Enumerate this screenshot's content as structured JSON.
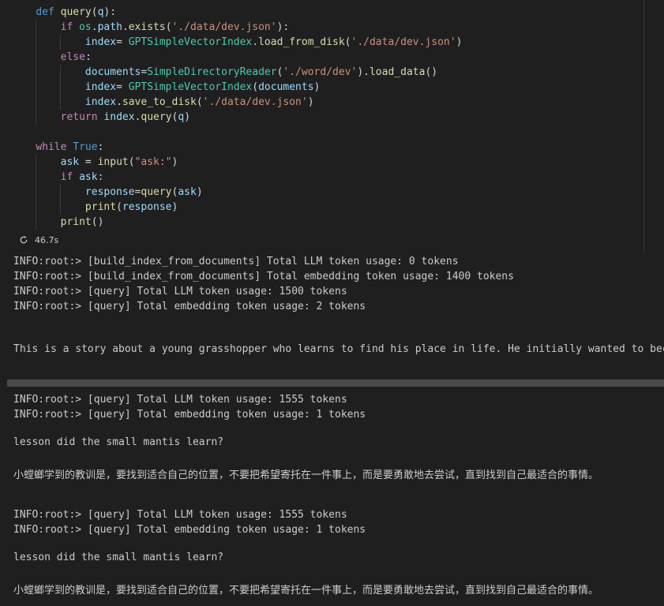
{
  "code": {
    "l1": {
      "kw": "def",
      "fn": "query",
      "open": "(",
      "param": "q",
      "close": "):"
    },
    "l2": {
      "kw": "if",
      "mod": "os",
      "dot1": ".",
      "attr": "path",
      "dot2": ".",
      "fn": "exists",
      "open": "(",
      "str": "'./data/dev.json'",
      "close": "):"
    },
    "l3": {
      "var": "index",
      "eq": "= ",
      "cls": "GPTSimpleVectorIndex",
      "dot": ".",
      "fn": "load_from_disk",
      "open": "(",
      "str": "'./data/dev.json'",
      "close": ")"
    },
    "l4": {
      "kw": "else",
      "colon": ":"
    },
    "l5": {
      "var": "documents",
      "eq": "=",
      "cls": "SimpleDirectoryReader",
      "open": "(",
      "str": "'./word/dev'",
      "close": ").",
      "fn": "load_data",
      "tail": "()"
    },
    "l6": {
      "var": "index",
      "eq": "= ",
      "cls": "GPTSimpleVectorIndex",
      "open": "(",
      "arg": "documents",
      "close": ")"
    },
    "l7": {
      "var": "index",
      "dot": ".",
      "fn": "save_to_disk",
      "open": "(",
      "str": "'./data/dev.json'",
      "close": ")"
    },
    "l8": {
      "kw": "return",
      "var": "index",
      "dot": ".",
      "fn": "query",
      "open": "(",
      "arg": "q",
      "close": ")"
    },
    "l10": {
      "kw": "while",
      "const": "True",
      "colon": ":"
    },
    "l11": {
      "var": "ask",
      "eq": " = ",
      "fn": "input",
      "open": "(",
      "str": "\"ask:\"",
      "close": ")"
    },
    "l12": {
      "kw": "if",
      "var": "ask",
      "colon": ":"
    },
    "l13": {
      "var": "response",
      "eq": "=",
      "fn": "query",
      "open": "(",
      "arg": "ask",
      "close": ")"
    },
    "l14": {
      "fn": "print",
      "open": "(",
      "arg": "response",
      "close": ")"
    },
    "l15": {
      "fn": "print",
      "paren": "()"
    }
  },
  "status": {
    "time": "46.7s",
    "icon": "spinner-icon"
  },
  "output": {
    "o1": "INFO:root:> [build_index_from_documents] Total LLM token usage: 0 tokens",
    "o2": "INFO:root:> [build_index_from_documents] Total embedding token usage: 1400 tokens",
    "o3": "INFO:root:> [query] Total LLM token usage: 1500 tokens",
    "o4": "INFO:root:> [query] Total embedding token usage: 2 tokens",
    "o5": "This is a story about a young grasshopper who learns to find his place in life. He initially wanted to beco",
    "o6": "INFO:root:> [query] Total LLM token usage: 1555 tokens",
    "o7": "INFO:root:> [query] Total embedding token usage: 1 tokens",
    "o8": "lesson did the small mantis learn?",
    "o9": "小螳螂学到的教训是，要找到适合自己的位置，不要把希望寄托在一件事上，而是要勇敢地去尝试，直到找到自己最适合的事情。",
    "o10": "INFO:root:> [query] Total LLM token usage: 1555 tokens",
    "o11": "INFO:root:> [query] Total embedding token usage: 1 tokens",
    "o12": "lesson did the small mantis learn?",
    "o13": "小螳螂学到的教训是，要找到适合自己的位置，不要把希望寄托在一件事上，而是要勇敢地去尝试，直到找到自己最适合的事情。"
  },
  "colors": {
    "background": "#1f1f1f",
    "keyword": "#569cd6",
    "control": "#c586c0",
    "function": "#dcdcaa",
    "class": "#4ec9b0",
    "variable": "#9cdcfe",
    "string": "#ce9178"
  }
}
